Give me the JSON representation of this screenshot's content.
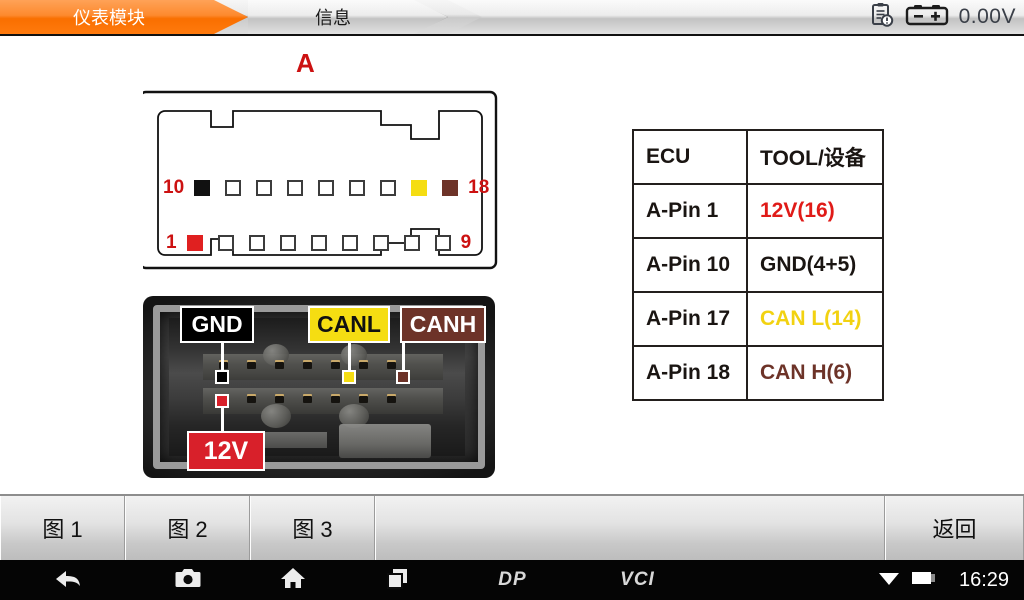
{
  "header": {
    "tabs": [
      {
        "label": "仪表模块",
        "active": true,
        "name": "tab-instrument-module"
      },
      {
        "label": "信息",
        "active": false,
        "name": "tab-information"
      }
    ],
    "status": {
      "report_icon": "clipboard-clock-icon",
      "battery_icon": "battery-icon",
      "voltage": "0.00V"
    }
  },
  "main": {
    "connector": {
      "label": "A",
      "top_row": {
        "left_number": "10",
        "right_number": "18",
        "pins": [
          "black",
          "white",
          "white",
          "white",
          "white",
          "white",
          "white",
          "yellow",
          "brown"
        ]
      },
      "bottom_row": {
        "left_number": "1",
        "right_number": "9",
        "pins": [
          "red",
          "white",
          "white",
          "white",
          "white",
          "white",
          "white",
          "white",
          "white"
        ]
      }
    },
    "photo": {
      "callouts": [
        {
          "label": "GND",
          "color": "#000000",
          "text_color": "#ffffff",
          "name": "callout-gnd"
        },
        {
          "label": "CANL",
          "color": "#f5dd12",
          "text_color": "#111111",
          "name": "callout-canl"
        },
        {
          "label": "CANH",
          "color": "#6d3328",
          "text_color": "#ffffff",
          "name": "callout-canh"
        },
        {
          "label": "12V",
          "color": "#d8202a",
          "text_color": "#ffffff",
          "name": "callout-12v"
        }
      ]
    },
    "table": {
      "headers": [
        "ECU",
        "TOOL/设备"
      ],
      "rows": [
        {
          "ecu": "A-Pin 1",
          "tool": "12V(16)",
          "tool_color": "#e01b18"
        },
        {
          "ecu": "A-Pin 10",
          "tool": "GND(4+5)",
          "tool_color": "#1a1512"
        },
        {
          "ecu": "A-Pin 17",
          "tool": "CAN L(14)",
          "tool_color": "#f2d211"
        },
        {
          "ecu": "A-Pin 18",
          "tool": "CAN H(6)",
          "tool_color": "#6d3328"
        }
      ]
    }
  },
  "buttons": [
    {
      "label": "图 1",
      "name": "button-figure-1"
    },
    {
      "label": "图 2",
      "name": "button-figure-2"
    },
    {
      "label": "图 3",
      "name": "button-figure-3"
    },
    {
      "label": "返回",
      "name": "button-back"
    }
  ],
  "navbar": {
    "back_icon": "back-arrow-icon",
    "screenshot_icon": "camera-icon",
    "home_icon": "home-icon",
    "recents_icon": "recents-icon",
    "dp_label": "DP",
    "vci_label": "VCI",
    "wifi_icon": "wifi-icon",
    "battery_icon": "battery-icon",
    "time": "16:29"
  }
}
